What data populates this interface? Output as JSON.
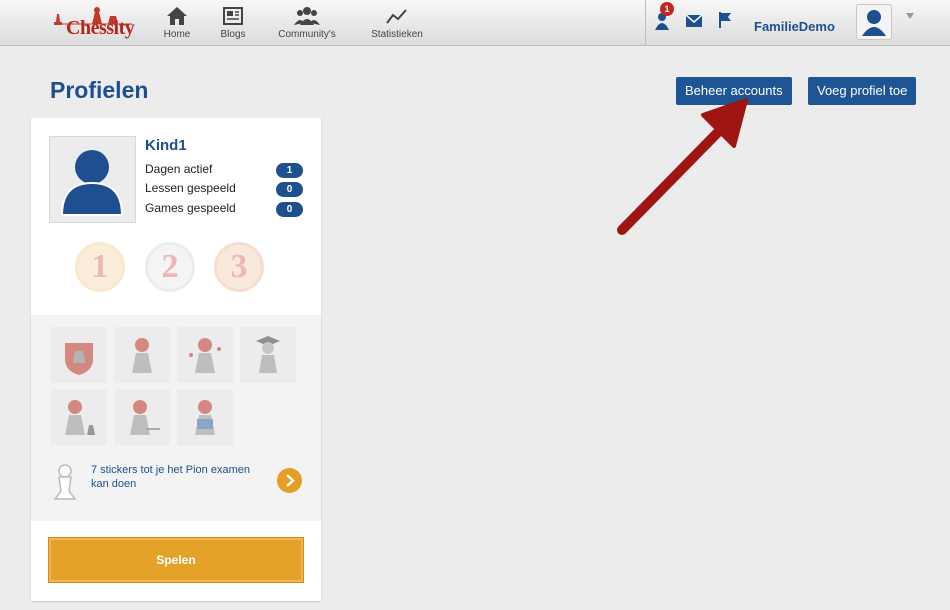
{
  "brand": {
    "name": "Chessity"
  },
  "nav": [
    {
      "label": "Home",
      "icon": "home-icon"
    },
    {
      "label": "Blogs",
      "icon": "blogs-icon"
    },
    {
      "label": "Community's",
      "icon": "community-icon"
    },
    {
      "label": "Statistieken",
      "icon": "statistics-icon"
    }
  ],
  "header": {
    "notification_count": "1",
    "username": "FamilieDemo"
  },
  "page": {
    "title": "Profielen",
    "manage_accounts_label": "Beheer accounts",
    "add_profile_label": "Voeg profiel toe"
  },
  "profile": {
    "name": "Kind1",
    "stats": [
      {
        "label": "Dagen actief",
        "value": "1"
      },
      {
        "label": "Lessen gespeeld",
        "value": "0"
      },
      {
        "label": "Games gespeeld",
        "value": "0"
      }
    ],
    "medals": [
      "1",
      "2",
      "3"
    ],
    "sticker_message": "7 stickers tot je het Pion examen kan doen",
    "play_label": "Spelen"
  },
  "colors": {
    "brand_blue": "#1e4f8f",
    "accent_orange": "#e5a22a",
    "annotation_red": "#9e1512"
  }
}
